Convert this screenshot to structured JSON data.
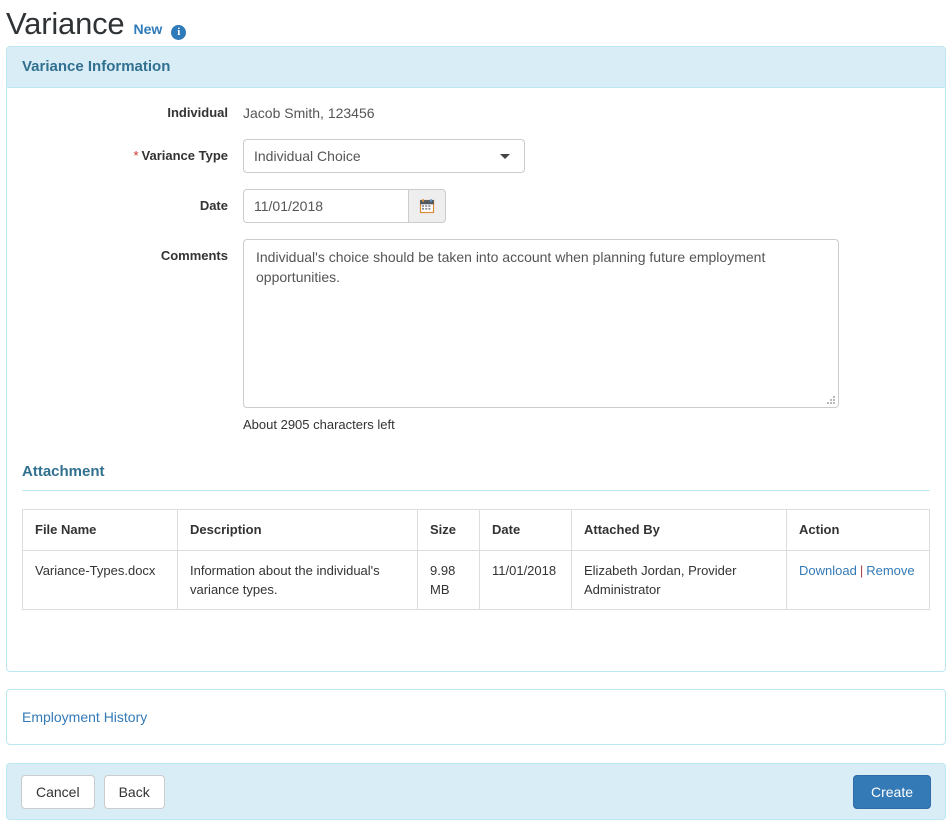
{
  "header": {
    "title": "Variance",
    "status": "New",
    "info_icon": "info-circle-icon",
    "info_glyph": "i"
  },
  "panel": {
    "heading": "Variance Information"
  },
  "form": {
    "individual": {
      "label": "Individual",
      "value": "Jacob Smith, 123456"
    },
    "variance_type": {
      "label": "Variance Type",
      "required_marker": "*",
      "value": "Individual Choice",
      "caret_icon": "chevron-down-icon"
    },
    "date": {
      "label": "Date",
      "value": "11/01/2018",
      "placeholder": "mm/dd/yyyy",
      "calendar_icon": "calendar-icon"
    },
    "comments": {
      "label": "Comments",
      "value": "Individual's choice should be taken into account when planning future employment opportunities.",
      "placeholder": "",
      "help_text": "About 2905 characters left"
    }
  },
  "attachment": {
    "title": "Attachment",
    "columns": [
      "File Name",
      "Description",
      "Size",
      "Date",
      "Attached By",
      "Action"
    ],
    "rows": [
      {
        "file_name": "Variance-Types.docx",
        "description": "Information about the individual's variance types.",
        "size": "9.98 MB",
        "date": "11/01/2018",
        "attached_by": "Elizabeth Jordan, Provider Administrator",
        "action_download": "Download",
        "action_separator": "|",
        "action_remove": "Remove"
      }
    ]
  },
  "sections": {
    "employment_history": "Employment History"
  },
  "footer": {
    "cancel": "Cancel",
    "back": "Back",
    "create": "Create"
  },
  "colors": {
    "accent": "#337ab7",
    "panel_heading_bg": "#d9edf7",
    "panel_border": "#bce8f1",
    "heading_text": "#31708f",
    "required": "#c9302c"
  }
}
